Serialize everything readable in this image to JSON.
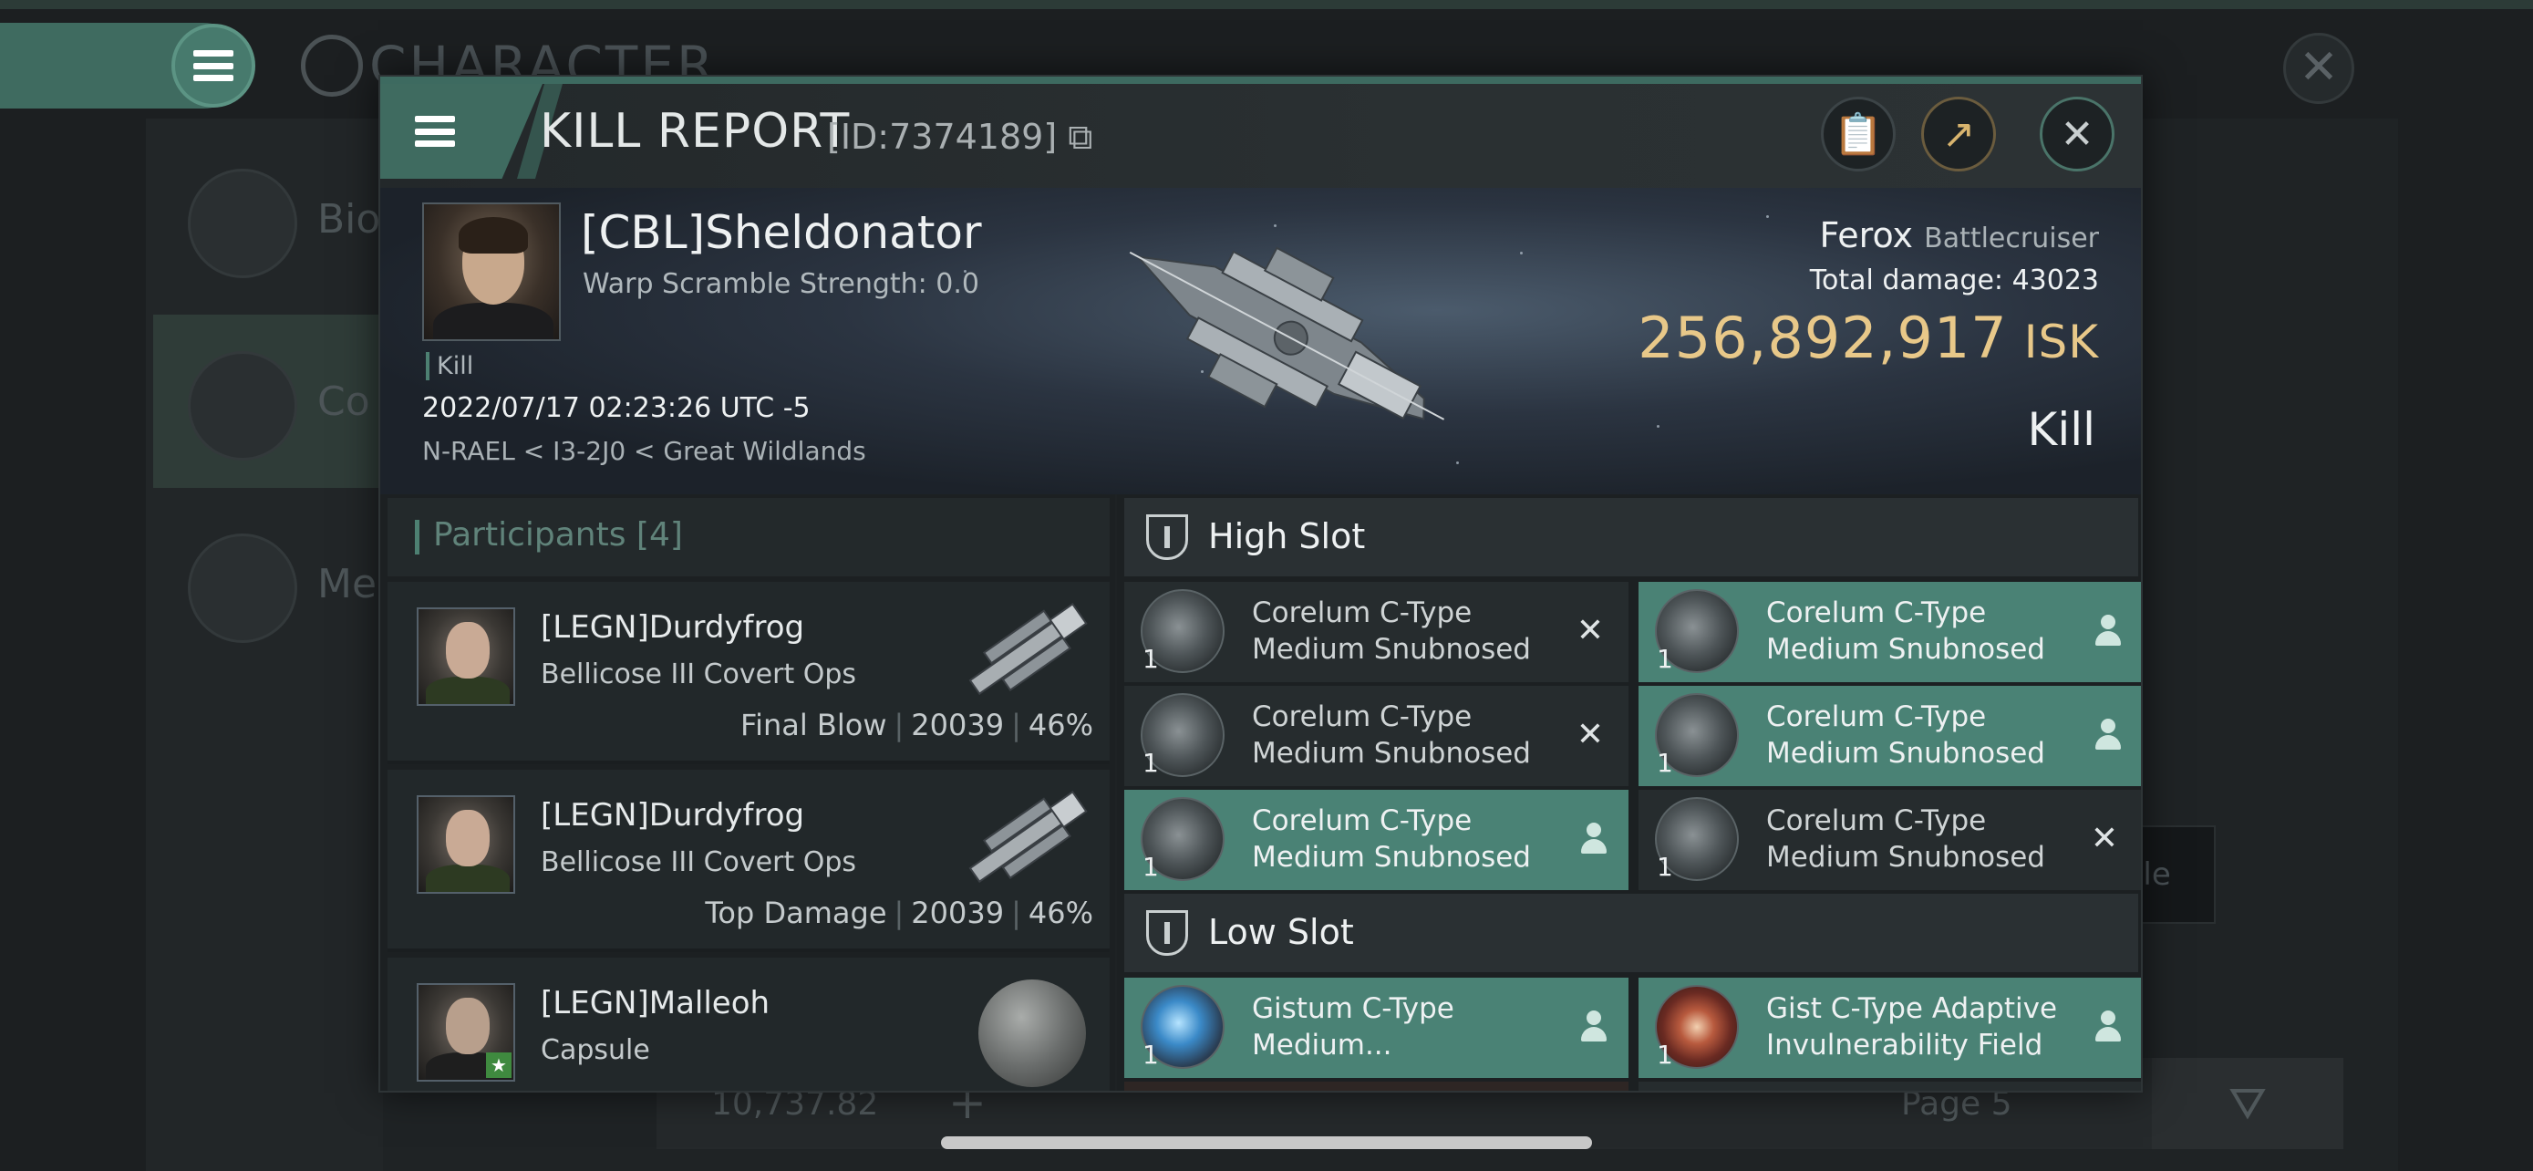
{
  "background": {
    "title": "CHARACTER",
    "sidebar": [
      {
        "label": "Bio"
      },
      {
        "label": "Co"
      },
      {
        "label": "Me"
      }
    ],
    "usable_label": "able",
    "price": "10,737.82",
    "page_label": "Page 5"
  },
  "dialog": {
    "title": "KILL REPORT",
    "id_text": "[ID:7374189]",
    "victim": {
      "name": "[CBL]Sheldonator",
      "warp_scramble": "Warp Scramble Strength: 0.0",
      "kill_tag": "Kill",
      "timestamp": "2022/07/17 02:23:26 UTC -5",
      "location": "N-RAEL < I3-2J0 < Great Wildlands",
      "ship_name": "Ferox",
      "ship_class": "Battlecruiser",
      "total_damage_label": "Total damage:",
      "total_damage": "43023",
      "isk_value": "256,892,917",
      "isk_unit": "ISK",
      "result": "Kill"
    },
    "participants": {
      "title": "Participants",
      "count": "[4]",
      "rows": [
        {
          "name": "[LEGN]Durdyfrog",
          "ship": "Bellicose III Covert Ops",
          "role": "Final Blow",
          "damage": "20039",
          "percent": "46%"
        },
        {
          "name": "[LEGN]Durdyfrog",
          "ship": "Bellicose III Covert Ops",
          "role": "Top Damage",
          "damage": "20039",
          "percent": "46%"
        },
        {
          "name": "[LEGN]Malleoh",
          "ship": "Capsule"
        }
      ]
    },
    "high_slot": {
      "label": "High Slot",
      "modules": [
        {
          "name_line1": "Corelum C-Type",
          "name_line2": "Medium Snubnosed ...",
          "qty": "1",
          "status": "destroyed"
        },
        {
          "name_line1": "Corelum C-Type",
          "name_line2": "Medium Snubnosed ...",
          "qty": "1",
          "status": "dropped"
        },
        {
          "name_line1": "Corelum C-Type",
          "name_line2": "Medium Snubnosed ...",
          "qty": "1",
          "status": "destroyed"
        },
        {
          "name_line1": "Corelum C-Type",
          "name_line2": "Medium Snubnosed ...",
          "qty": "1",
          "status": "dropped"
        },
        {
          "name_line1": "Corelum C-Type",
          "name_line2": "Medium Snubnosed ...",
          "qty": "1",
          "status": "dropped"
        },
        {
          "name_line1": "Corelum C-Type",
          "name_line2": "Medium Snubnosed ...",
          "qty": "1",
          "status": "destroyed"
        }
      ]
    },
    "low_slot": {
      "label": "Low Slot",
      "modules": [
        {
          "name_line1": "Gistum C-Type",
          "name_line2": "Medium...",
          "qty": "1",
          "status": "dropped"
        },
        {
          "name_line1": "Gist C-Type Adaptive",
          "name_line2": "Invulnerability Field",
          "qty": "1",
          "status": "dropped"
        }
      ]
    }
  },
  "icons": {
    "menu": "hamburger-icon",
    "clipboard": "clipboard-icon",
    "share": "share-icon",
    "close": "close-icon",
    "slot": "slot-shield-icon",
    "destroyed": "destroyed-x-icon",
    "dropped": "dropped-person-icon"
  },
  "colors": {
    "accent": "#3f6b60",
    "isk": "#e8c889",
    "dropped_bg": "#4a8275"
  }
}
